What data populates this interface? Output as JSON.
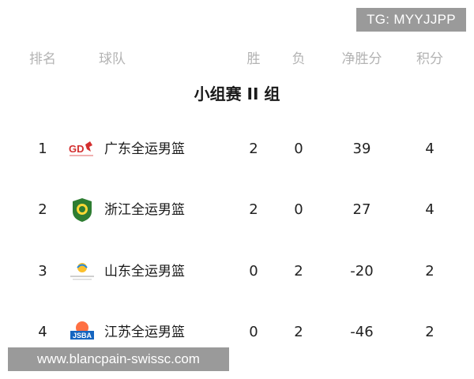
{
  "watermark_top": "TG: MYYJJPP",
  "watermark_bottom": "www.blancpain-swissc.com",
  "header": {
    "rank": "排名",
    "team": "球队",
    "wins": "胜",
    "losses": "负",
    "net": "净胜分",
    "points": "积分"
  },
  "group_title": "小组赛 II 组",
  "rows": [
    {
      "rank": "1",
      "logo": "guangdong-logo",
      "team": "广东全运男篮",
      "wins": "2",
      "losses": "0",
      "net": "39",
      "points": "4"
    },
    {
      "rank": "2",
      "logo": "zhejiang-logo",
      "team": "浙江全运男篮",
      "wins": "2",
      "losses": "0",
      "net": "27",
      "points": "4"
    },
    {
      "rank": "3",
      "logo": "shandong-logo",
      "team": "山东全运男篮",
      "wins": "0",
      "losses": "2",
      "net": "-20",
      "points": "2"
    },
    {
      "rank": "4",
      "logo": "jiangsu-logo",
      "team": "江苏全运男篮",
      "wins": "0",
      "losses": "2",
      "net": "-46",
      "points": "2"
    }
  ],
  "colors": {
    "header_text": "#b3b3b3",
    "watermark_bg": "#9a9a9a",
    "zhejiang_green": "#2e7d32",
    "guangdong_red": "#d32f2f",
    "jiangsu_blue": "#1565c0"
  }
}
